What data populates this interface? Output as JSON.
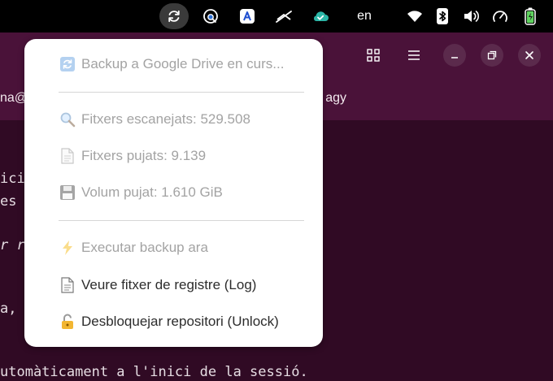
{
  "panel": {
    "keyboard_layout": "en"
  },
  "terminal": {
    "title_left": "na@",
    "title_right": "r — agy",
    "lines": [
      "ici",
      "es",
      "r re",
      "a, c",
      "utomàticament a l'inici de la sessió."
    ]
  },
  "menu": {
    "status": "Backup a Google Drive en curs...",
    "files_scanned": "Fitxers escanejats: 529.508",
    "files_uploaded": "Fitxers pujats: 9.139",
    "volume_uploaded": "Volum pujat: 1.610 GiB",
    "run_backup": "Executar backup ara",
    "view_log": "Veure fitxer de registre (Log)",
    "unlock": "Desbloquejar repositori (Unlock)"
  },
  "colors": {
    "panel_bg": "#000000",
    "terminal_bg": "#300a24",
    "titlebar_bg": "#4a1239",
    "menu_bg": "#ffffff",
    "disabled_text": "#a3a3a3",
    "enabled_text": "#2c2c2c",
    "accent_teal": "#2bb5a6",
    "battery_green": "#5fd35f"
  }
}
